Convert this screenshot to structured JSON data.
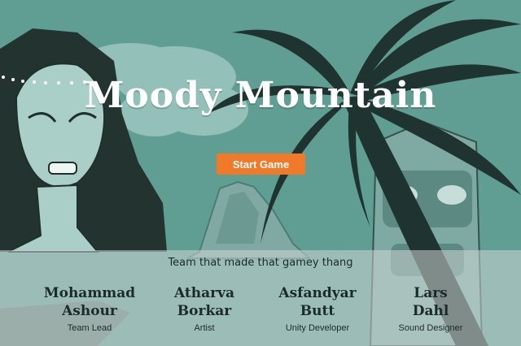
{
  "game": {
    "title": "Moody Mountain",
    "start_label": "Start Game"
  },
  "team": {
    "heading": "Team that made that gamey thang",
    "members": [
      {
        "first": "Mohammad",
        "last": "Ashour",
        "role": "Team Lead"
      },
      {
        "first": "Atharva",
        "last": "Borkar",
        "role": "Artist"
      },
      {
        "first": "Asfandyar",
        "last": "Butt",
        "role": "Unity Developer"
      },
      {
        "first": "Lars",
        "last": "Dahl",
        "role": "Sound Designer"
      }
    ]
  },
  "colors": {
    "background": "#5f9d93",
    "accent": "#f07a2a",
    "ink": "#1f3330"
  }
}
